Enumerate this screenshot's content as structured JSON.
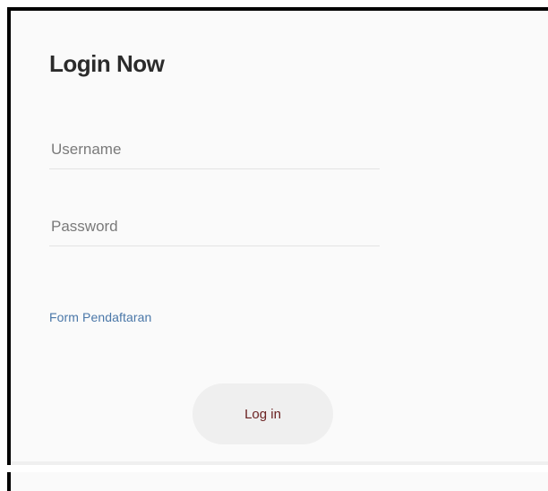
{
  "login": {
    "title": "Login Now",
    "username_placeholder": "Username",
    "username_value": "",
    "password_placeholder": "Password",
    "password_value": "",
    "register_link": "Form Pendaftaran",
    "login_button": "Log in"
  },
  "colors": {
    "link": "#4a77a8",
    "button_text": "#6b2222",
    "button_bg": "#efefef",
    "frame_border": "#000000"
  }
}
